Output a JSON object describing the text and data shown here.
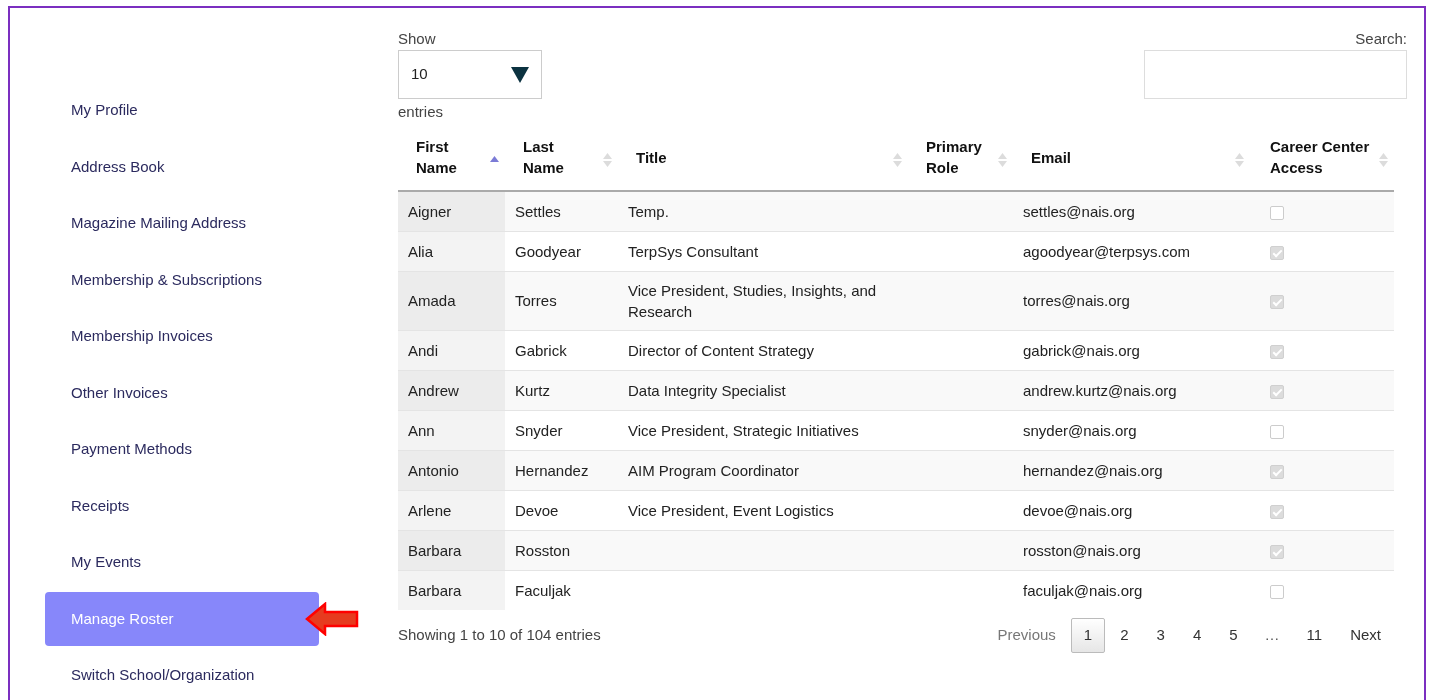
{
  "sidebar": {
    "items": [
      {
        "label": "My Profile",
        "selected": false
      },
      {
        "label": "Address Book",
        "selected": false
      },
      {
        "label": "Magazine Mailing Address",
        "selected": false
      },
      {
        "label": "Membership & Subscriptions",
        "selected": false
      },
      {
        "label": "Membership Invoices",
        "selected": false
      },
      {
        "label": "Other Invoices",
        "selected": false
      },
      {
        "label": "Payment Methods",
        "selected": false
      },
      {
        "label": "Receipts",
        "selected": false
      },
      {
        "label": "My Events",
        "selected": false
      },
      {
        "label": "Manage Roster",
        "selected": true
      },
      {
        "label": "Switch School/Organization",
        "selected": false
      }
    ]
  },
  "length_menu": {
    "before": "Show",
    "value": "10",
    "after": "entries"
  },
  "search": {
    "label": "Search:"
  },
  "table": {
    "columns": [
      {
        "label": "First Name",
        "sorted": true
      },
      {
        "label": "Last Name",
        "sorted": false
      },
      {
        "label": "Title",
        "sorted": false
      },
      {
        "label": "Primary Role",
        "sorted": false
      },
      {
        "label": "Email",
        "sorted": false
      },
      {
        "label": "Career Center Access",
        "sorted": false
      }
    ],
    "rows": [
      {
        "first": "Aigner",
        "last": "Settles",
        "title": "Temp.",
        "email": "settles@nais.org",
        "access": false,
        "disabled": true
      },
      {
        "first": "Alia",
        "last": "Goodyear",
        "title": "TerpSys Consultant",
        "email": "agoodyear@terpsys.com",
        "access": true,
        "disabled": true
      },
      {
        "first": "Amada",
        "last": "Torres",
        "title": "Vice President, Studies, Insights, and Research",
        "email": "torres@nais.org",
        "access": true,
        "disabled": true
      },
      {
        "first": "Andi",
        "last": "Gabrick",
        "title": "Director of Content Strategy",
        "email": "gabrick@nais.org",
        "access": true,
        "disabled": true
      },
      {
        "first": "Andrew",
        "last": "Kurtz",
        "title": "Data Integrity Specialist",
        "email": "andrew.kurtz@nais.org",
        "access": true,
        "disabled": true
      },
      {
        "first": "Ann",
        "last": "Snyder",
        "title": "Vice President, Strategic Initiatives",
        "email": "snyder@nais.org",
        "access": false,
        "disabled": true
      },
      {
        "first": "Antonio",
        "last": "Hernandez",
        "title": "AIM Program Coordinator",
        "email": "hernandez@nais.org",
        "access": true,
        "disabled": true
      },
      {
        "first": "Arlene",
        "last": "Devoe",
        "title": "Vice President, Event Logistics",
        "email": "devoe@nais.org",
        "access": true,
        "disabled": true
      },
      {
        "first": "Barbara",
        "last": "Rosston",
        "email": "rosston@nais.org",
        "access": true,
        "disabled": true
      },
      {
        "first": "Barbara",
        "last": "Faculjak",
        "email": "faculjak@nais.org",
        "access": false,
        "disabled": true
      }
    ]
  },
  "info": "Showing 1 to 10 of 104 entries",
  "pagination": [
    {
      "label": "Previous",
      "kind": "nav",
      "disabled": true
    },
    {
      "label": "1",
      "kind": "page",
      "selected": true
    },
    {
      "label": "2",
      "kind": "page",
      "selected": false
    },
    {
      "label": "3",
      "kind": "page",
      "selected": false
    },
    {
      "label": "4",
      "kind": "page",
      "selected": false
    },
    {
      "label": "5",
      "kind": "page",
      "selected": false
    },
    {
      "label": "…",
      "kind": "gap"
    },
    {
      "label": "11",
      "kind": "page",
      "selected": false
    },
    {
      "label": "Next",
      "kind": "nav",
      "disabled": false
    }
  ]
}
